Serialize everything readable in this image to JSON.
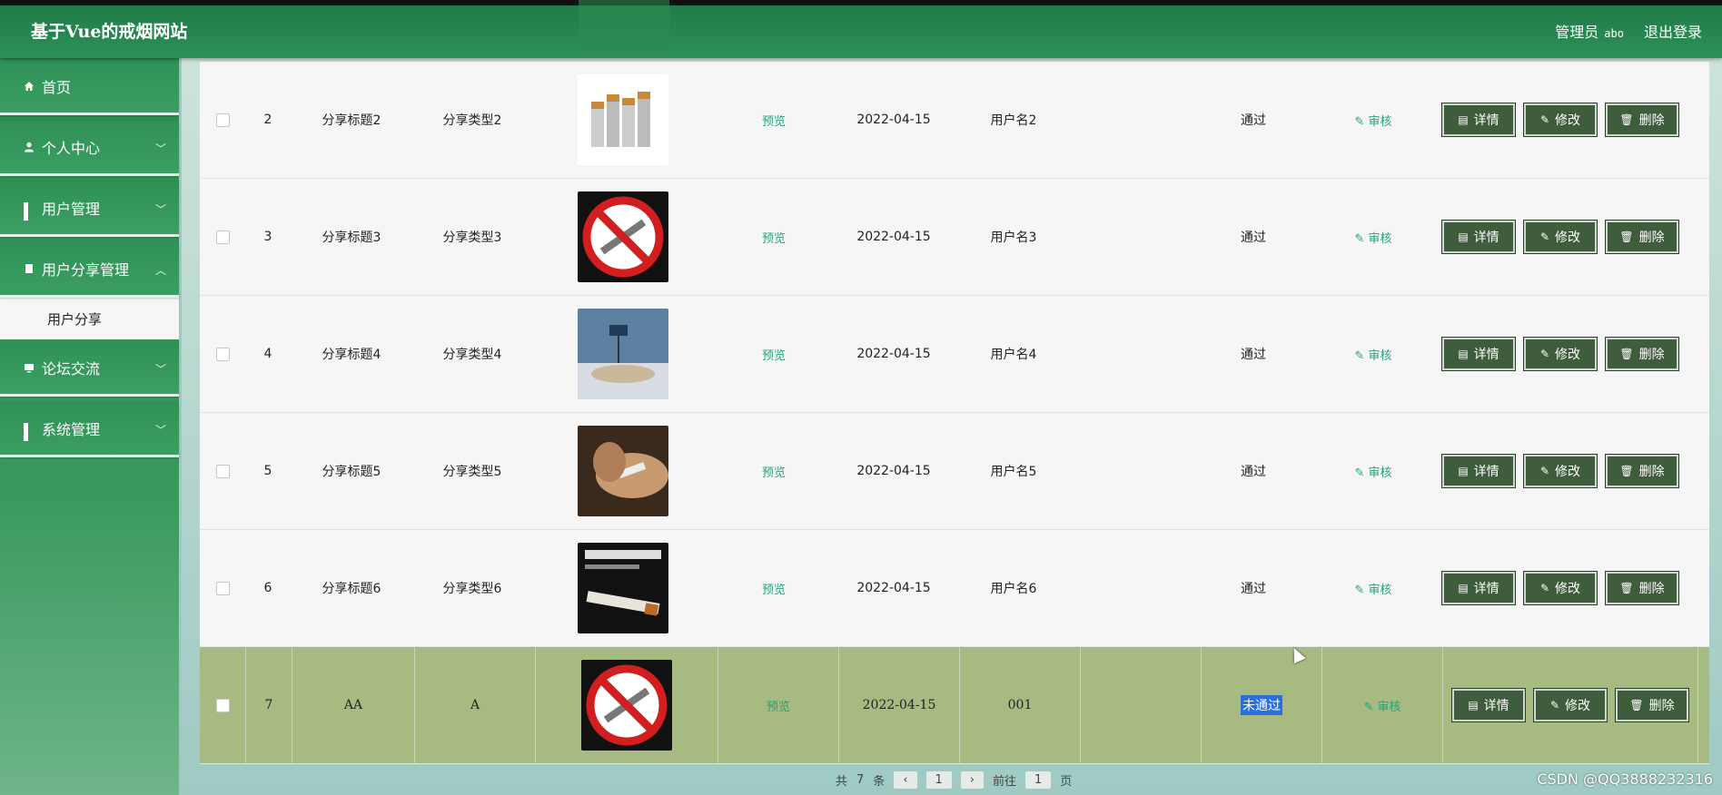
{
  "header": {
    "site_title": "基于Vue的戒烟网站",
    "user_label": "管理员",
    "user_name": "abo",
    "logout_label": "退出登录"
  },
  "sidebar": {
    "items": [
      {
        "label": "首页",
        "icon": "home-icon"
      },
      {
        "label": "个人中心",
        "icon": "user-icon"
      },
      {
        "label": "用户管理",
        "icon": "grid-icon"
      },
      {
        "label": "用户分享管理",
        "icon": "document-icon"
      },
      {
        "label": "论坛交流",
        "icon": "monitor-icon"
      },
      {
        "label": "系统管理",
        "icon": "grid-icon"
      }
    ],
    "sub_items": [
      {
        "label": "用户分享"
      }
    ]
  },
  "table": {
    "preview_label": "预览",
    "audit_label": "审核",
    "detail_label": "详情",
    "edit_label": "修改",
    "delete_label": "删除",
    "rows": [
      {
        "idx": "2",
        "title": "分享标题2",
        "type": "分享类型2",
        "date": "2022-04-15",
        "user": "用户名2",
        "status": "通过"
      },
      {
        "idx": "3",
        "title": "分享标题3",
        "type": "分享类型3",
        "date": "2022-04-15",
        "user": "用户名3",
        "status": "通过"
      },
      {
        "idx": "4",
        "title": "分享标题4",
        "type": "分享类型4",
        "date": "2022-04-15",
        "user": "用户名4",
        "status": "通过"
      },
      {
        "idx": "5",
        "title": "分享标题5",
        "type": "分享类型5",
        "date": "2022-04-15",
        "user": "用户名5",
        "status": "通过"
      },
      {
        "idx": "6",
        "title": "分享标题6",
        "type": "分享类型6",
        "date": "2022-04-15",
        "user": "用户名6",
        "status": "通过"
      },
      {
        "idx": "7",
        "title": "AA",
        "type": "A",
        "date": "2022-04-15",
        "user": "001",
        "status": "未通过"
      }
    ]
  },
  "pager": {
    "total_prefix": "共",
    "total": "7",
    "total_suffix": "条",
    "page": "1",
    "goto_label": "前往",
    "goto_value": "1",
    "page_suffix": "页"
  },
  "watermark": "CSDN @QQ3888232316",
  "colors": {
    "primary_green": "#2d8f56",
    "button_bg": "#3f5c3c",
    "link_green": "#2aa377",
    "highlight_row": "#a7ba82"
  }
}
